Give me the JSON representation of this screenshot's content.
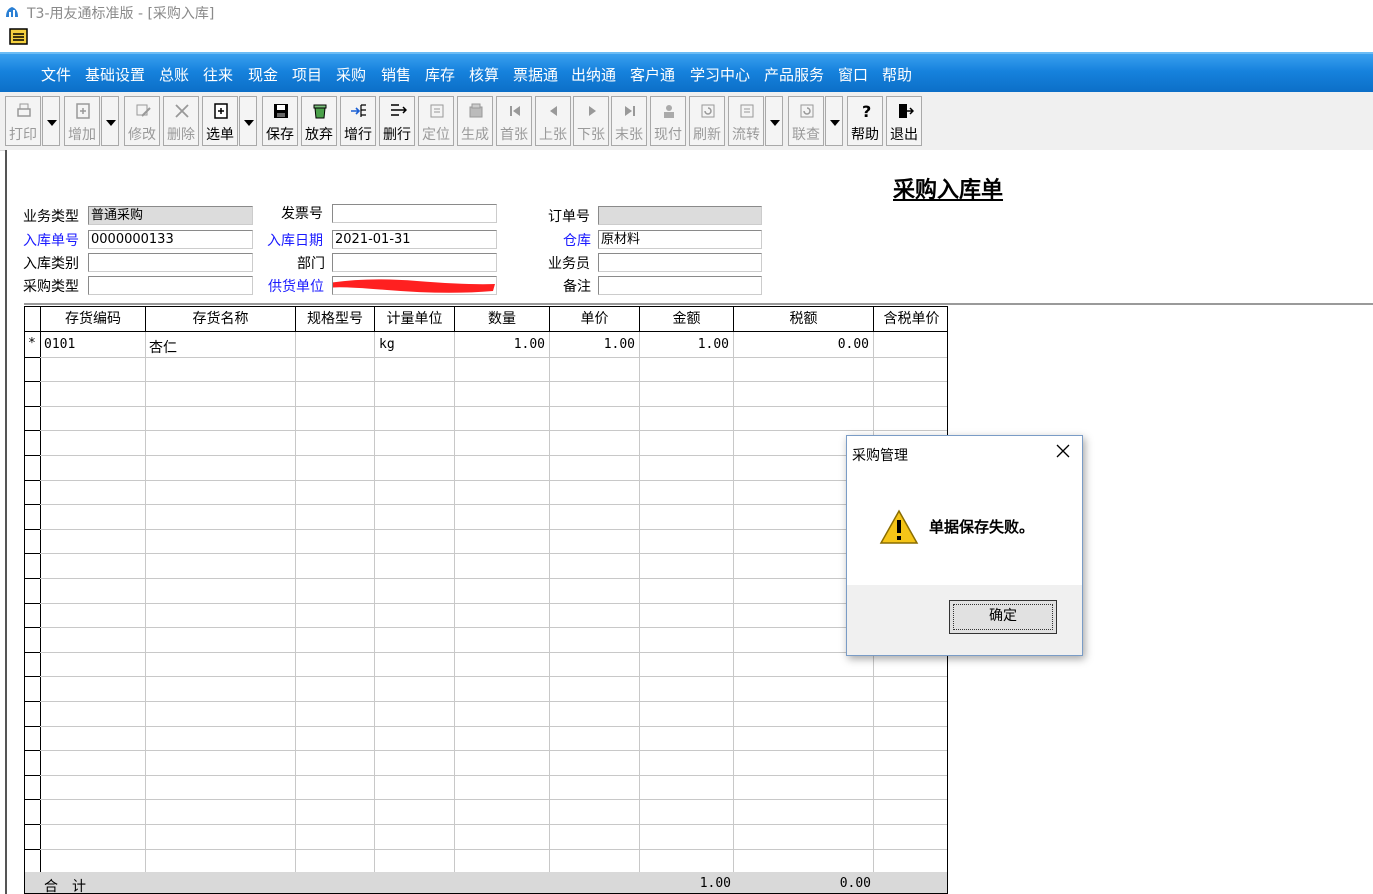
{
  "window": {
    "title": "T3-用友通标准版 - [采购入库]"
  },
  "menu": [
    "文件",
    "基础设置",
    "总账",
    "往来",
    "现金",
    "项目",
    "采购",
    "销售",
    "库存",
    "核算",
    "票据通",
    "出纳通",
    "客户通",
    "学习中心",
    "产品服务",
    "窗口",
    "帮助"
  ],
  "toolbar": {
    "print": "打印",
    "add": "增加",
    "modify": "修改",
    "delete": "删除",
    "select": "选单",
    "save": "保存",
    "discard": "放弃",
    "add_row": "增行",
    "delete_row": "删行",
    "locate": "定位",
    "generate": "生成",
    "first": "首张",
    "prev": "上张",
    "next": "下张",
    "last": "末张",
    "pay_now": "现付",
    "refresh": "刷新",
    "flow": "流转",
    "link": "联查",
    "help": "帮助",
    "exit": "退出"
  },
  "form": {
    "title": "采购入库单",
    "business_type_label": "业务类型",
    "business_type": "普通采购",
    "invoice_no_label": "发票号",
    "invoice_no": "",
    "order_no_label": "订单号",
    "order_no": "",
    "receipt_no_label": "入库单号",
    "receipt_no": "0000000133",
    "receipt_date_label": "入库日期",
    "receipt_date": "2021-01-31",
    "warehouse_label": "仓库",
    "warehouse": "原材料",
    "receipt_category_label": "入库类别",
    "receipt_category": "",
    "department_label": "部门",
    "department": "",
    "salesperson_label": "业务员",
    "salesperson": "",
    "purchase_type_label": "采购类型",
    "purchase_type": "",
    "supplier_label": "供货单位",
    "remark_label": "备注",
    "remark": ""
  },
  "grid": {
    "columns": [
      "存货编码",
      "存货名称",
      "规格型号",
      "计量单位",
      "数量",
      "单价",
      "金额",
      "税额",
      "含税单价"
    ],
    "rows": [
      {
        "marker": "*",
        "code": "0101",
        "name": "杏仁",
        "spec": "",
        "unit": "kg",
        "qty": "1.00",
        "price": "1.00",
        "amount": "1.00",
        "tax": "0.00",
        "tax_price": ""
      }
    ],
    "total_label": "合　计",
    "total_amount": "1.00",
    "total_tax": "0.00"
  },
  "dialog": {
    "title": "采购管理",
    "message": "单据保存失败。",
    "ok": "确定"
  }
}
